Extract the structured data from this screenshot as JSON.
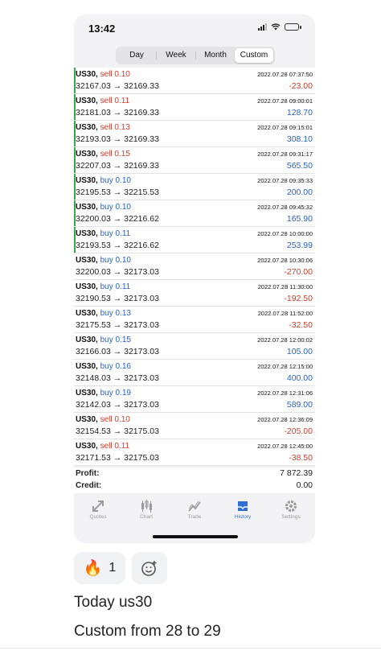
{
  "status_bar": {
    "time": "13:42"
  },
  "period_tabs": [
    {
      "label": "Day",
      "active": false
    },
    {
      "label": "Week",
      "active": false
    },
    {
      "label": "Month",
      "active": false
    },
    {
      "label": "Custom",
      "active": true
    }
  ],
  "trades": [
    {
      "symbol": "US30,",
      "side": "sell 0.10",
      "type": "sell",
      "prices": "32167.03 → 32169.33",
      "datetime": "2022.07.28 07:37:50",
      "profit": "-23.00",
      "accent": true
    },
    {
      "symbol": "US30,",
      "side": "sell 0.11",
      "type": "sell",
      "prices": "32181.03 → 32169.33",
      "datetime": "2022.07.28 09:00:01",
      "profit": "128.70",
      "accent": true
    },
    {
      "symbol": "US30,",
      "side": "sell 0.13",
      "type": "sell",
      "prices": "32193.03 → 32169.33",
      "datetime": "2022.07.28 09:15:01",
      "profit": "308.10",
      "accent": true
    },
    {
      "symbol": "US30,",
      "side": "sell 0.15",
      "type": "sell",
      "prices": "32207.03 → 32169.33",
      "datetime": "2022.07.28 09:31:17",
      "profit": "565.50",
      "accent": true
    },
    {
      "symbol": "US30,",
      "side": "buy 0.10",
      "type": "buy",
      "prices": "32195.53 → 32215.53",
      "datetime": "2022.07.28 09:35:33",
      "profit": "200.00",
      "accent": true
    },
    {
      "symbol": "US30,",
      "side": "buy 0.10",
      "type": "buy",
      "prices": "32200.03 → 32216.62",
      "datetime": "2022.07.28 09:45:32",
      "profit": "165.90",
      "accent": true
    },
    {
      "symbol": "US30,",
      "side": "buy 0.11",
      "type": "buy",
      "prices": "32193.53 → 32216.62",
      "datetime": "2022.07.28 10:00:00",
      "profit": "253.99",
      "accent": true
    },
    {
      "symbol": "US30,",
      "side": "buy 0.10",
      "type": "buy",
      "prices": "32200.03 → 32173.03",
      "datetime": "2022.07.28 10:30:06",
      "profit": "-270.00",
      "accent": false
    },
    {
      "symbol": "US30,",
      "side": "buy 0.11",
      "type": "buy",
      "prices": "32190.53 → 32173.03",
      "datetime": "2022.07.28 11:30:00",
      "profit": "-192.50",
      "accent": false
    },
    {
      "symbol": "US30,",
      "side": "buy 0.13",
      "type": "buy",
      "prices": "32175.53 → 32173.03",
      "datetime": "2022.07.28 11:52:00",
      "profit": "-32.50",
      "accent": false
    },
    {
      "symbol": "US30,",
      "side": "buy 0.15",
      "type": "buy",
      "prices": "32166.03 → 32173.03",
      "datetime": "2022.07.28 12:00:02",
      "profit": "105.00",
      "accent": false
    },
    {
      "symbol": "US30,",
      "side": "buy 0.16",
      "type": "buy",
      "prices": "32148.03 → 32173.03",
      "datetime": "2022.07.28 12:15:00",
      "profit": "400.00",
      "accent": false
    },
    {
      "symbol": "US30,",
      "side": "buy 0.19",
      "type": "buy",
      "prices": "32142.03 → 32173.03",
      "datetime": "2022.07.28 12:31:06",
      "profit": "589.00",
      "accent": false
    },
    {
      "symbol": "US30,",
      "side": "sell 0.10",
      "type": "sell",
      "prices": "32154.53 → 32175.03",
      "datetime": "2022.07.28 12:36:09",
      "profit": "-205.00",
      "accent": false
    },
    {
      "symbol": "US30,",
      "side": "sell 0.11",
      "type": "sell",
      "prices": "32171.53 → 32175.03",
      "datetime": "2022.07.28 12:45:00",
      "profit": "-38.50",
      "accent": false
    }
  ],
  "summary": {
    "profit_label": "Profit:",
    "profit_value": "7 872.39",
    "credit_label": "Credit:",
    "credit_value": "0.00"
  },
  "tab_bar": [
    {
      "label": "Quotes",
      "icon": "quotes-icon",
      "active": false
    },
    {
      "label": "Chart",
      "icon": "chart-icon",
      "active": false
    },
    {
      "label": "Trade",
      "icon": "trade-icon",
      "active": false
    },
    {
      "label": "History",
      "icon": "history-icon",
      "active": true
    },
    {
      "label": "Settings",
      "icon": "settings-icon",
      "active": false
    }
  ],
  "reactions": {
    "emoji": "🔥",
    "count": "1"
  },
  "message": {
    "line1": "Today us30",
    "line2": "Custom from 28 to 29"
  },
  "colors": {
    "sell": "#d23a2a",
    "buy": "#2762c9",
    "accent": "#3aa84a",
    "active_tab": "#2f6fd6"
  }
}
